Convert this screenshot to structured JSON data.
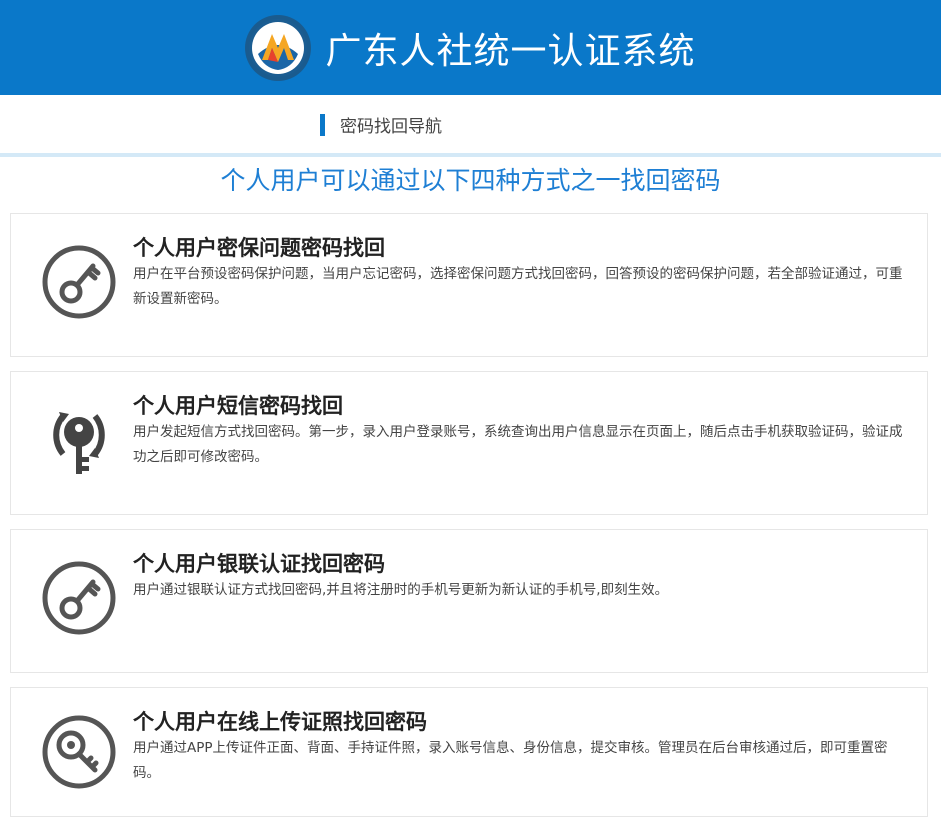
{
  "header": {
    "title": "广东人社统一认证系统"
  },
  "nav": {
    "title": "密码找回导航"
  },
  "subtitle": "个人用户可以通过以下四种方式之一找回密码",
  "cards": [
    {
      "title": "个人用户密保问题密码找回",
      "desc": "用户在平台预设密码保护问题，当用户忘记密码，选择密保问题方式找回密码，回答预设的密码保护问题，若全部验证通过，可重新设置新密码。",
      "icon": "key-circle-icon"
    },
    {
      "title": "个人用户短信密码找回",
      "desc": "用户发起短信方式找回密码。第一步，录入用户登录账号，系统查询出用户信息显示在页面上，随后点击手机获取验证码，验证成功之后即可修改密码。",
      "icon": "key-signal-icon"
    },
    {
      "title": "个人用户银联认证找回密码",
      "desc": "用户通过银联认证方式找回密码,并且将注册时的手机号更新为新认证的手机号,即刻生效。",
      "icon": "key-circle-icon"
    },
    {
      "title": "个人用户在线上传证照找回密码",
      "desc": "用户通过APP上传证件正面、背面、手持证件照，录入账号信息、身份信息，提交审核。管理员在后台审核通过后，即可重置密码。",
      "icon": "key-search-icon"
    }
  ]
}
